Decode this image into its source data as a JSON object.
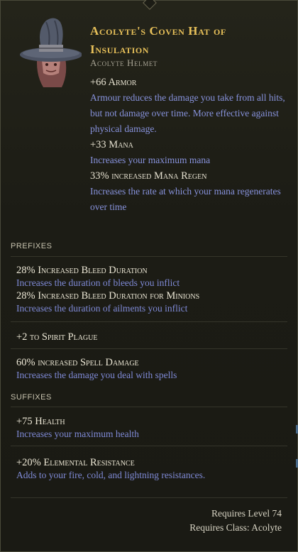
{
  "item": {
    "name": "Acolyte's Coven Hat of Insulation",
    "base_type": "Acolyte Helmet",
    "icon": "coven-hat-icon",
    "implicits": [
      {
        "stat": "+66 Armor",
        "desc": "Armour reduces the damage you take from all hits, but not damage over time. More effective against physical damage."
      },
      {
        "stat": "+33 Mana",
        "desc": "Increases your maximum mana"
      },
      {
        "stat": "33% increased Mana Regen",
        "desc": "Increases the rate at which your mana regenerates over time"
      }
    ]
  },
  "prefixes": {
    "label": "PREFIXES",
    "groups": [
      {
        "lines": [
          {
            "stat": "28% Increased Bleed Duration",
            "desc": "Increases the duration of bleeds you inflict"
          },
          {
            "stat": "28% Increased Bleed Duration for Minions",
            "desc": "Increases the duration of ailments you inflict"
          }
        ]
      },
      {
        "lines": [
          {
            "stat": "+2 to Spirit Plague",
            "desc": ""
          }
        ]
      },
      {
        "lines": [
          {
            "stat": "60% increased Spell Damage",
            "desc": "Increases the damage you deal with spells"
          }
        ]
      }
    ]
  },
  "suffixes": {
    "label": "SUFFIXES",
    "groups": [
      {
        "lines": [
          {
            "stat": "+75 Health",
            "desc": "Increases your maximum health"
          }
        ]
      },
      {
        "lines": [
          {
            "stat": "+20% Elemental Resistance",
            "desc": "Adds to your fire, cold, and lightning resistances."
          }
        ]
      }
    ]
  },
  "requirements": {
    "level": "Requires Level 74",
    "class": "Requires Class: Acolyte"
  },
  "colors": {
    "title": "#e8c15a",
    "description": "#8792dc",
    "stat": "#ede8d6"
  }
}
